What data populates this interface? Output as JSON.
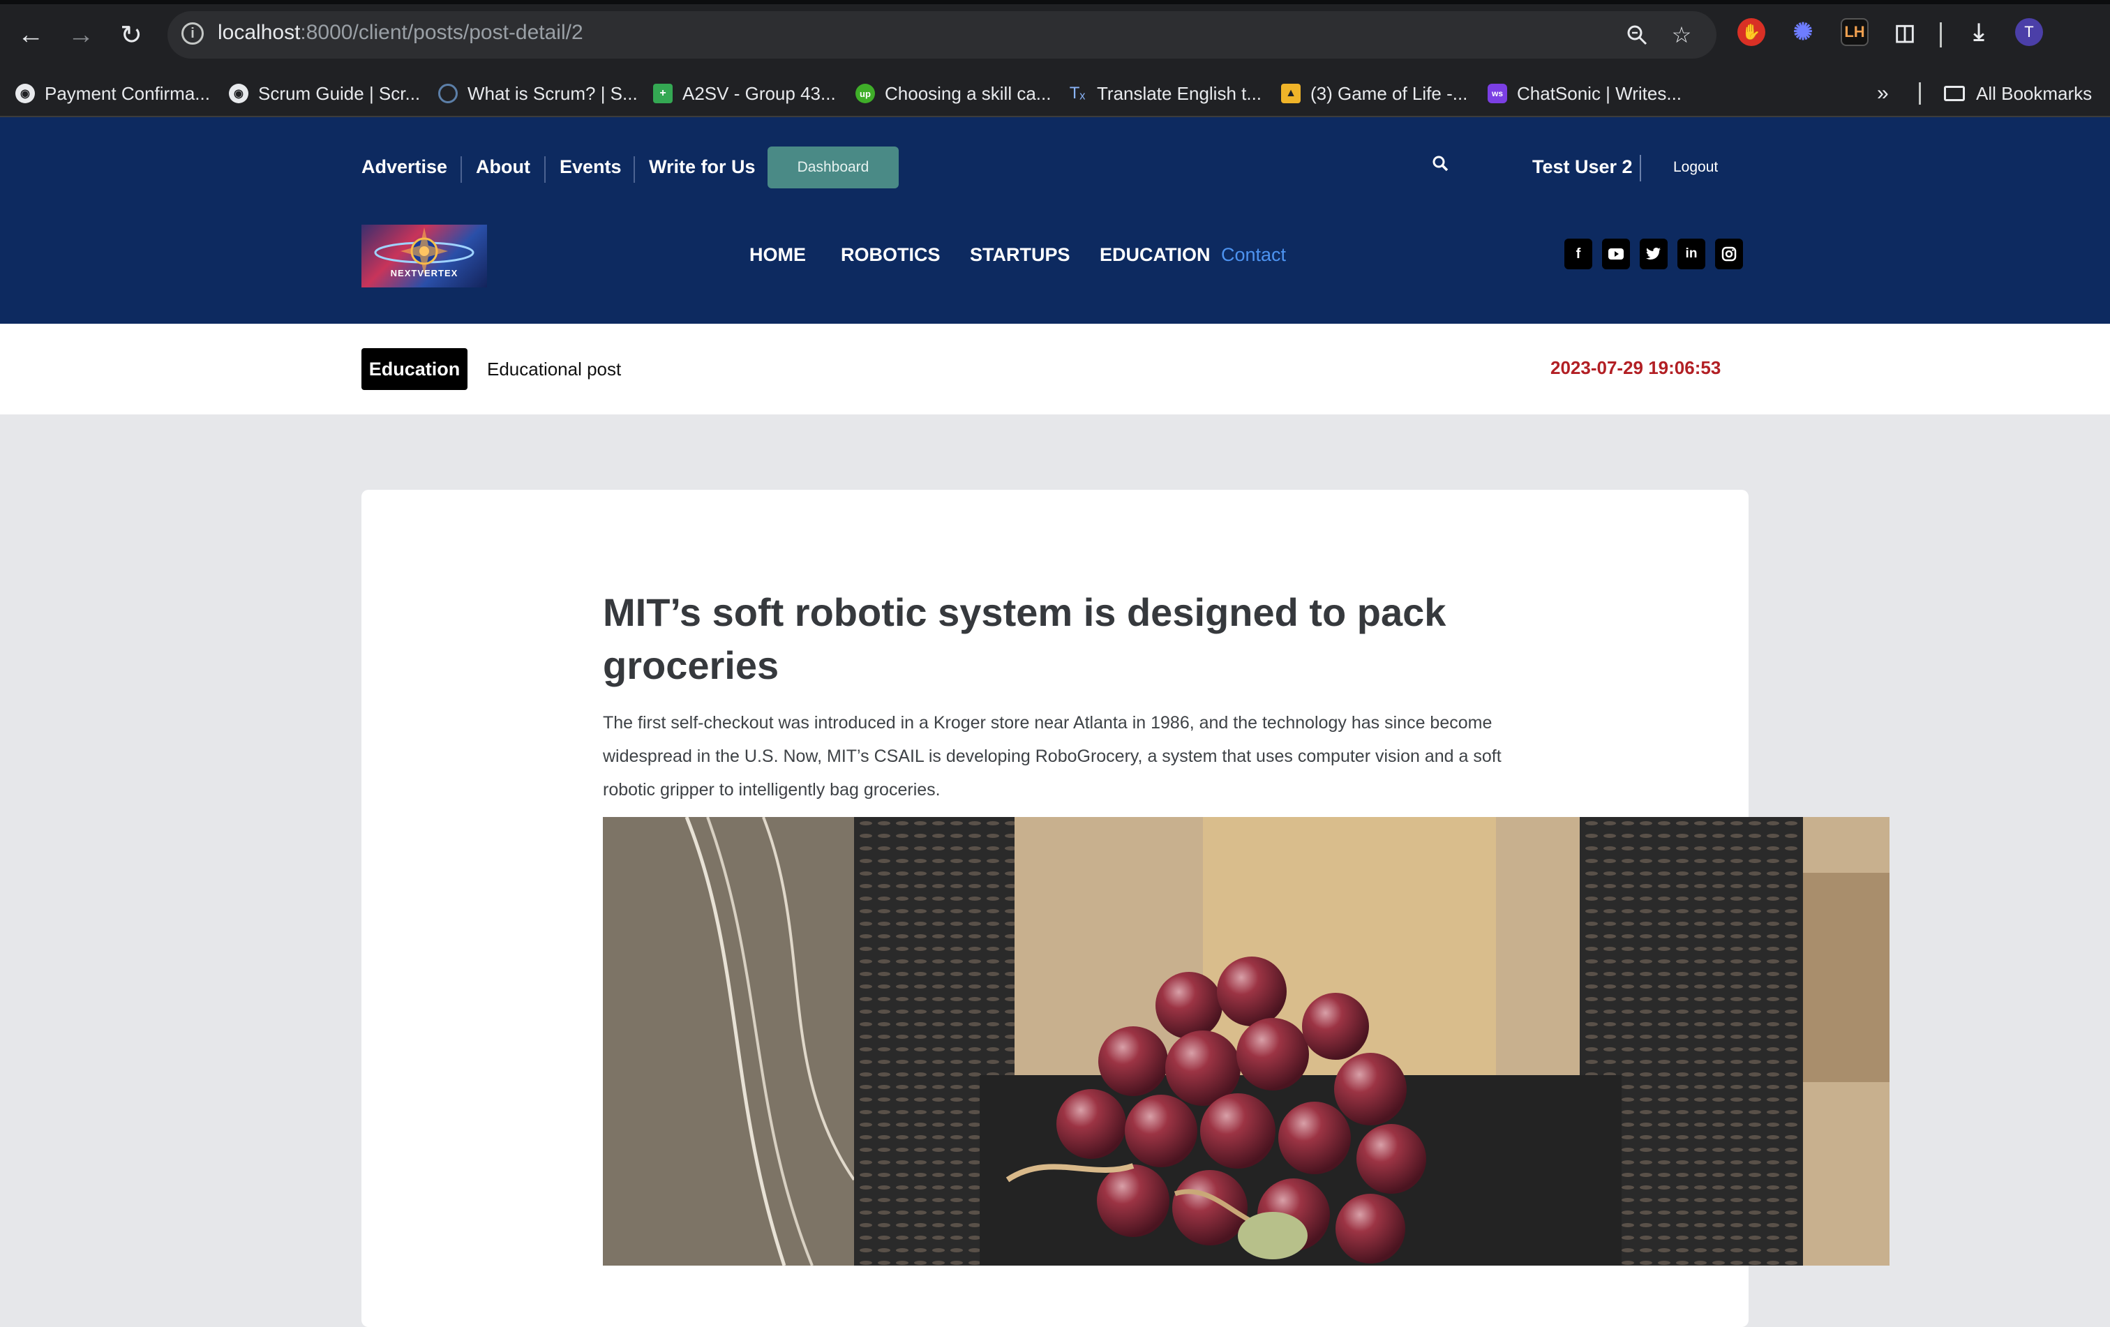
{
  "browser": {
    "url_host": "localhost",
    "url_path": ":8000/client/posts/post-detail/2",
    "profile_initial": "T",
    "bookmarks": [
      {
        "label": "Payment Confirma..."
      },
      {
        "label": "Scrum Guide | Scr..."
      },
      {
        "label": "What is Scrum? | S..."
      },
      {
        "label": "A2SV - Group 43..."
      },
      {
        "label": "Choosing a skill ca..."
      },
      {
        "label": "Translate English t..."
      },
      {
        "label": "(3) Game of Life -..."
      },
      {
        "label": "ChatSonic | Writes..."
      }
    ],
    "all_bookmarks": "All Bookmarks"
  },
  "header": {
    "top_links": [
      "Advertise",
      "About",
      "Events",
      "Write for Us"
    ],
    "dashboard_label": "Dashboard",
    "user_name": "Test User 2",
    "logout_label": "Logout",
    "logo_text": "NEXTVERTEX",
    "main_nav": [
      "HOME",
      "ROBOTICS",
      "STARTUPS",
      "EDUCATION",
      "Contact"
    ],
    "social": [
      "facebook-icon",
      "youtube-icon",
      "twitter-icon",
      "linkedin-icon",
      "instagram-icon"
    ],
    "bg_color": "#0d2a60"
  },
  "category_bar": {
    "category": "Education",
    "description": "Educational post",
    "date": "2023-07-29 19:06:53",
    "date_color": "#b21f24"
  },
  "article": {
    "title": "MIT’s soft robotic system is designed to pack groceries",
    "lead": "The first self-checkout was introduced in a Kroger store near Atlanta in 1986, and the technology has since become widespread in the U.S. Now, MIT’s CSAIL is developing RoboGrocery, a system that uses computer vision and a soft robotic gripper to intelligently bag groceries."
  }
}
